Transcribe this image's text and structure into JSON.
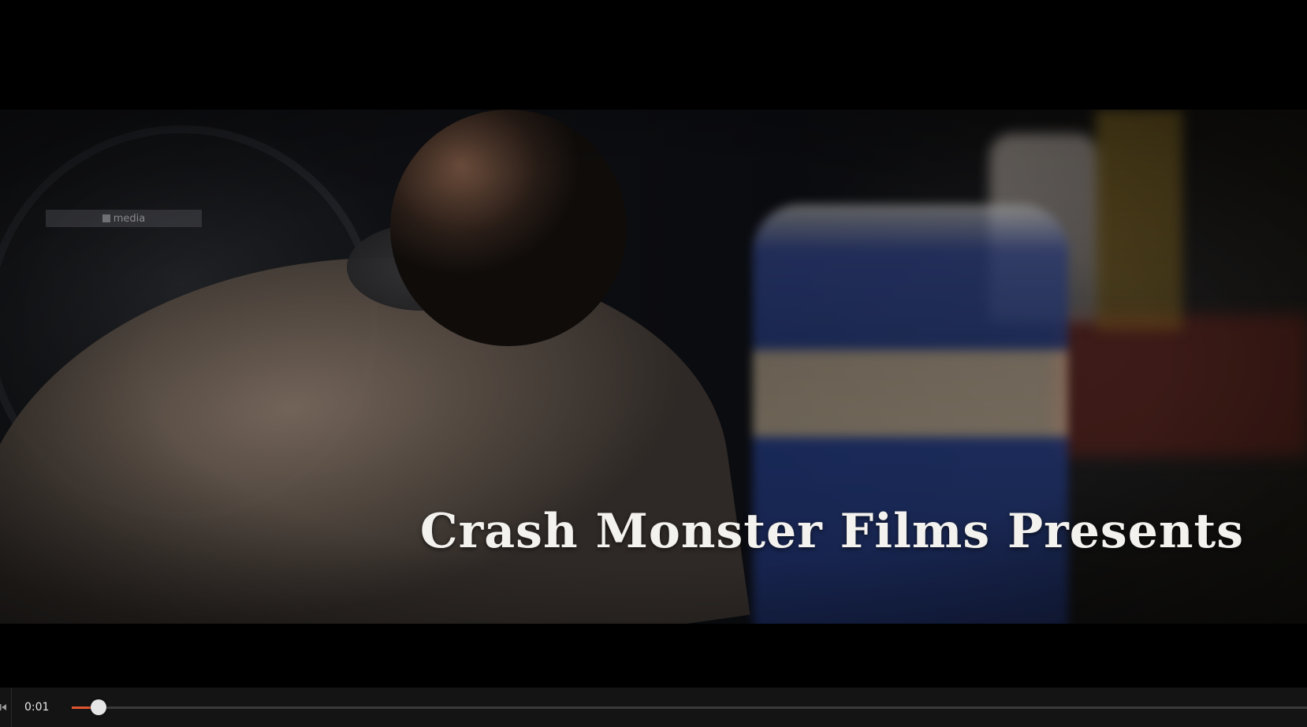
{
  "video": {
    "overlay_title": "Crash Monster Films Presents",
    "watermark_label": "media"
  },
  "controls": {
    "current_time": "0:01",
    "progress_fraction": 0.022,
    "accent_color": "#e0542e",
    "track_color": "#3a3a3a",
    "skip_icon": "skip-back-icon"
  }
}
